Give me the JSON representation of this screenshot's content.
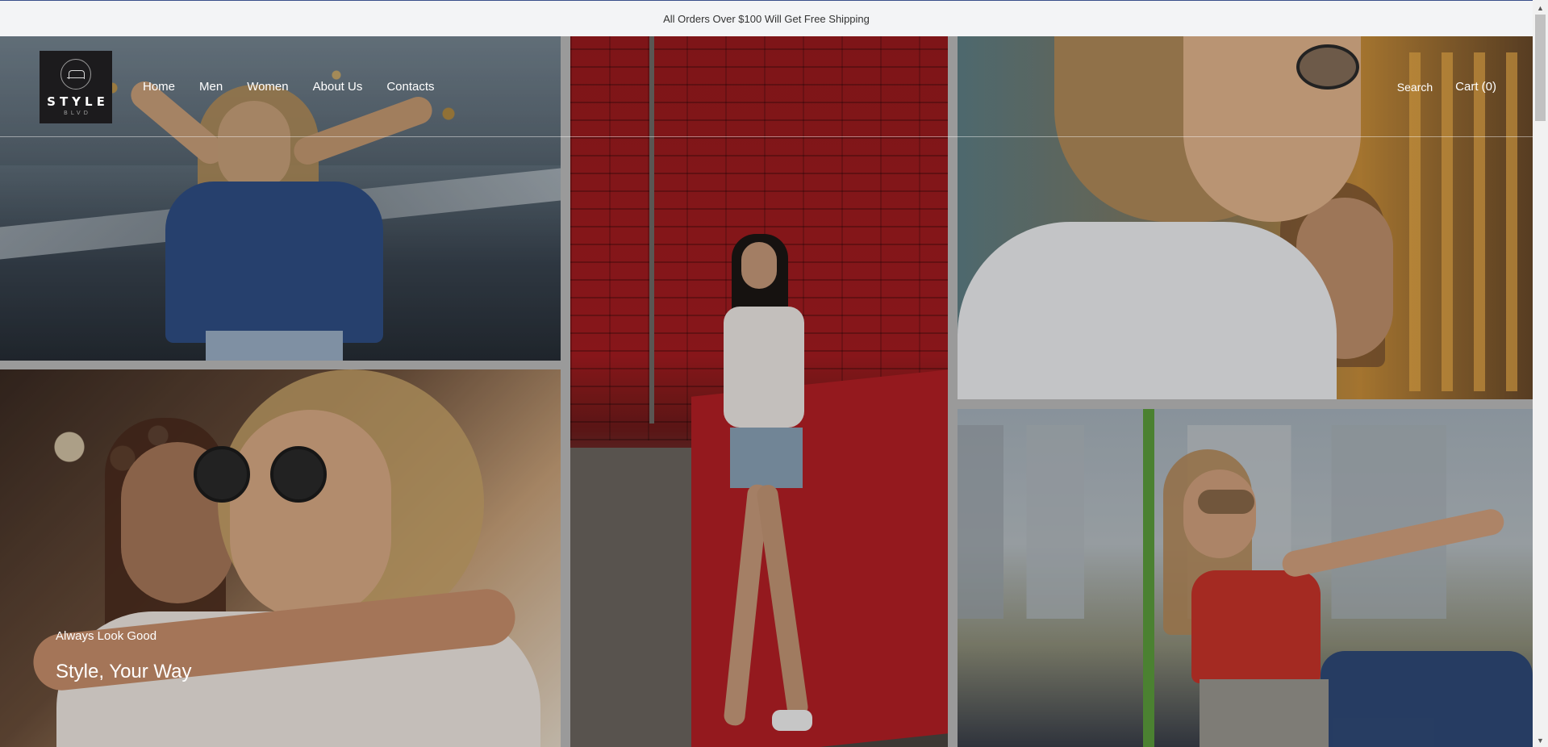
{
  "announcement": {
    "text": "All Orders Over $100 Will Get Free Shipping"
  },
  "logo": {
    "word": "STYLE",
    "sub": "BLVD",
    "icon": "hanger-icon"
  },
  "nav": {
    "items": [
      {
        "label": "Home"
      },
      {
        "label": "Men"
      },
      {
        "label": "Women"
      },
      {
        "label": "About Us"
      },
      {
        "label": "Contacts"
      }
    ],
    "search_label": "Search",
    "cart_label": "Cart (0)"
  },
  "hero": {
    "kicker": "Always Look Good",
    "headline": "Style, Your Way"
  },
  "colors": {
    "announce_bg": "#f3f4f6",
    "logo_bg": "#1c1b1d",
    "nav_text": "#ffffff"
  }
}
